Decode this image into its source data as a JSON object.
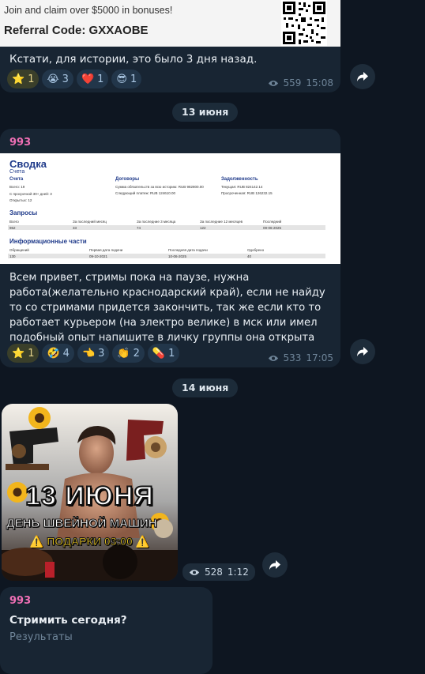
{
  "msg1": {
    "banner_promo": "Join and claim over $5000 in bonuses!",
    "banner_code": "Referral Code: GXXAOBE",
    "text": "Кстати, для истории, это было 3 дня назад.",
    "reactions": [
      {
        "emoji": "⭐",
        "count": "1"
      },
      {
        "emoji": "😭",
        "count": "3"
      },
      {
        "emoji": "❤️",
        "count": "1"
      },
      {
        "emoji": "😎",
        "count": "1"
      }
    ],
    "views": "559",
    "time": "15:08"
  },
  "date1": "13 июня",
  "msg2": {
    "sender": "993",
    "doc": {
      "title": "Сводка",
      "subtitle": "Счета",
      "col_accounts": "Счета",
      "col_contracts": "Договоры",
      "col_debt": "Задолженность",
      "acc_lines": [
        "Всего: 19",
        "С просрочкой 30+ дней: 3",
        "Открытых: 12"
      ],
      "contract_lines": [
        "Сумма обязательств за всю историю: RUB 982800.00",
        "Следующий платеж: RUB 124610.00"
      ],
      "debt_lines": [
        "Текущая: RUB 824142.14",
        "Просроченная: RUB 126232.15"
      ],
      "requests_title": "Запросы",
      "requests_headers": [
        "Всего",
        "За последний месяц",
        "За последние 3 месяца",
        "За последние 12 месяцев",
        "Последний"
      ],
      "requests_values": [
        "962",
        "33",
        "74",
        "122",
        "09-06-2025"
      ],
      "info_title": "Информационные части",
      "info_headers": [
        "Обращений",
        "Первая дата подачи",
        "Последняя дата подачи",
        "Одобрено"
      ],
      "info_values": [
        "130",
        "09-10-2021",
        "10-06-2025",
        "40"
      ]
    },
    "text": "Всем привет, стримы пока на паузе, нужна работа(желательно краснодарский край), если не найду то со стримами придется закончить, так же если кто то работает курьером (на электро велике) в мск или имел подобный опыт напишите в личку группы она открыта",
    "reactions": [
      {
        "emoji": "⭐",
        "count": "1"
      },
      {
        "emoji": "🤣",
        "count": "4"
      },
      {
        "emoji": "👈",
        "count": "3"
      },
      {
        "emoji": "👏",
        "count": "2"
      },
      {
        "emoji": "💊",
        "count": "1"
      }
    ],
    "views": "533",
    "time": "17:05"
  },
  "date2": "14 июня",
  "msg3": {
    "poster_title": "13 ИЮНЯ",
    "poster_subtitle": "ДЕНЬ ШВЕЙНОЙ МАШИН",
    "poster_gifts": "⚠️ ПОДАРКИ 03:00 ⚠️",
    "views": "528",
    "time": "1:12"
  },
  "msg4": {
    "sender": "993",
    "question": "Стримить сегодня?",
    "results": "Результаты"
  },
  "colors": {
    "background": "#0e1621",
    "bubble": "#182533",
    "sender": "#ee6fb4",
    "accent": "#1f3a8a"
  }
}
